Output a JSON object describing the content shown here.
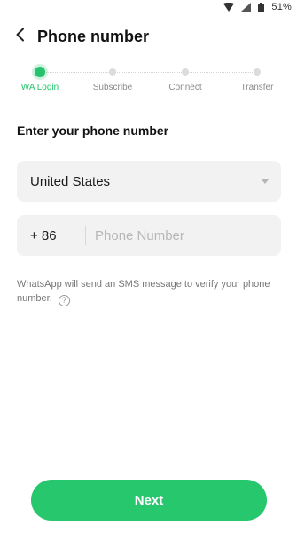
{
  "status_bar": {
    "battery": "51%",
    "icons": [
      "wifi-icon",
      "signal-icon",
      "battery-icon"
    ]
  },
  "header": {
    "back_icon": "chevron-left-icon",
    "title": "Phone number"
  },
  "stepper": {
    "steps": [
      {
        "label": "WA Login",
        "active": true
      },
      {
        "label": "Subscribe",
        "active": false
      },
      {
        "label": "Connect",
        "active": false
      },
      {
        "label": "Transfer",
        "active": false
      }
    ]
  },
  "form": {
    "heading": "Enter your phone number",
    "country": "United States",
    "country_code": "+ 86",
    "phone_placeholder": "Phone Number",
    "phone_value": "",
    "helper_text": "WhatsApp will send an SMS message to verify your phone number.",
    "help_icon": "question-circle-icon"
  },
  "actions": {
    "next_label": "Next"
  },
  "colors": {
    "accent": "#27c76d",
    "field_bg": "#f2f2f2"
  }
}
